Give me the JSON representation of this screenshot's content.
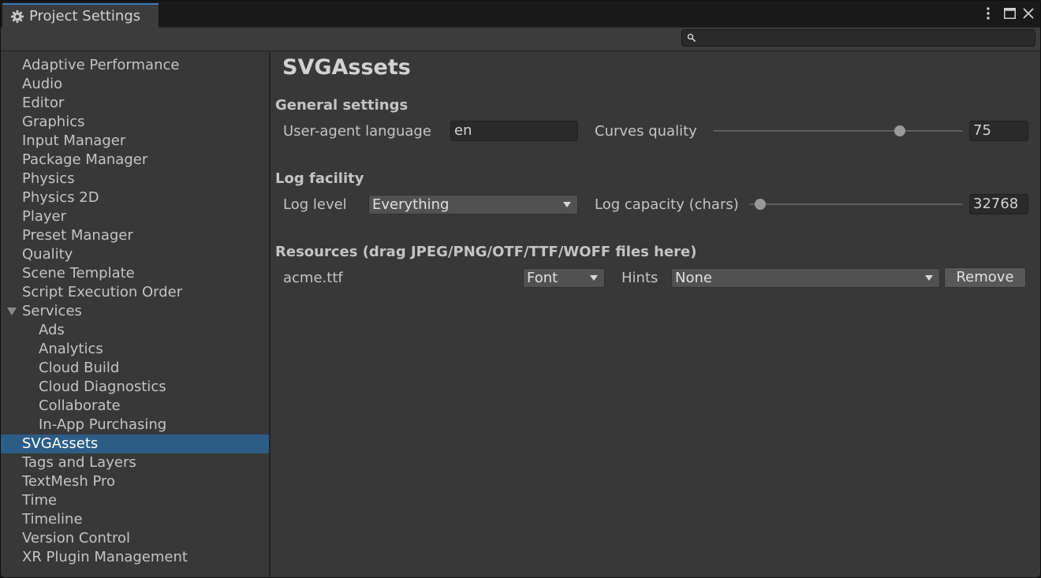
{
  "window": {
    "tab_title": "Project Settings",
    "icons": {
      "tab": "gear-icon",
      "menu": "kebab-menu-icon",
      "maximize": "maximize-icon",
      "close": "close-icon"
    }
  },
  "search": {
    "placeholder": "",
    "value": "",
    "icon": "search-icon"
  },
  "sidebar": {
    "items": [
      {
        "label": "Adaptive Performance"
      },
      {
        "label": "Audio"
      },
      {
        "label": "Editor"
      },
      {
        "label": "Graphics"
      },
      {
        "label": "Input Manager"
      },
      {
        "label": "Package Manager"
      },
      {
        "label": "Physics"
      },
      {
        "label": "Physics 2D"
      },
      {
        "label": "Player"
      },
      {
        "label": "Preset Manager"
      },
      {
        "label": "Quality"
      },
      {
        "label": "Scene Template"
      },
      {
        "label": "Script Execution Order"
      },
      {
        "label": "Services",
        "expanded": true
      },
      {
        "label": "Ads",
        "child": true
      },
      {
        "label": "Analytics",
        "child": true
      },
      {
        "label": "Cloud Build",
        "child": true
      },
      {
        "label": "Cloud Diagnostics",
        "child": true
      },
      {
        "label": "Collaborate",
        "child": true
      },
      {
        "label": "In-App Purchasing",
        "child": true
      },
      {
        "label": "SVGAssets",
        "selected": true
      },
      {
        "label": "Tags and Layers"
      },
      {
        "label": "TextMesh Pro"
      },
      {
        "label": "Time"
      },
      {
        "label": "Timeline"
      },
      {
        "label": "Version Control"
      },
      {
        "label": "XR Plugin Management"
      }
    ]
  },
  "main": {
    "title": "SVGAssets",
    "general": {
      "heading": "General settings",
      "language_label": "User-agent language",
      "language_value": "en",
      "curves_label": "Curves quality",
      "curves_value": "75",
      "curves_level": 75,
      "curves_range": [
        1,
        100
      ]
    },
    "log": {
      "heading": "Log facility",
      "level_label": "Log level",
      "level_value": "Everything",
      "capacity_label": "Log capacity (chars)",
      "capacity_value": "32768",
      "capacity_level_fraction": 0.05
    },
    "resources": {
      "heading": "Resources (drag JPEG/PNG/OTF/TTF/WOFF files here)",
      "items": [
        {
          "name": "acme.ttf",
          "type": "Font",
          "hints_label": "Hints",
          "hints": "None",
          "remove_label": "Remove"
        }
      ]
    }
  },
  "colors": {
    "selection": "#2c5d87",
    "accent": "#3a79bb",
    "background": "#383838"
  }
}
